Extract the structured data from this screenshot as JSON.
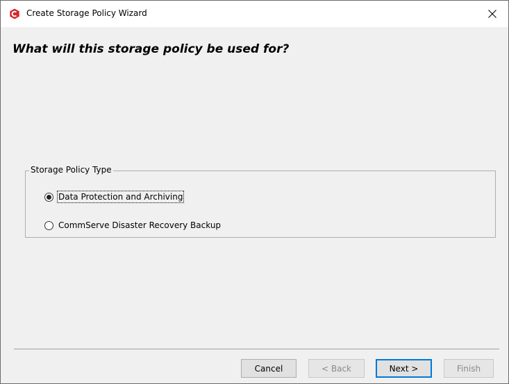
{
  "window": {
    "title": "Create Storage Policy Wizard",
    "app_icon": "commvault-logo-icon",
    "close_symbol": "✕"
  },
  "heading": "What will this storage policy be used for?",
  "policy_type_group": {
    "legend": "Storage Policy Type",
    "options": [
      {
        "label": "Data Protection and Archiving",
        "selected": true
      },
      {
        "label": "CommServe Disaster Recovery Backup",
        "selected": false
      }
    ]
  },
  "buttons": {
    "cancel": "Cancel",
    "back": "< Back",
    "next": "Next >",
    "finish": "Finish"
  },
  "colors": {
    "brand": "#d9252c",
    "focus_accent": "#0078d7"
  }
}
